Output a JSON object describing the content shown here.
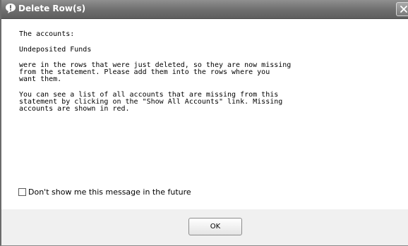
{
  "window": {
    "title": "Delete Row(s)"
  },
  "message": {
    "line1": "The accounts:",
    "line2": "Undeposited Funds",
    "para1": "were in the rows that were just deleted, so they are now missing\nfrom the statement. Please add them into the rows where you\nwant them.",
    "para2": "You can see a list of all accounts that are missing from this\nstatement by clicking on the \"Show All Accounts\" link. Missing\naccounts are shown in red."
  },
  "checkbox": {
    "label": "Don't show me this message in the future",
    "checked": false
  },
  "buttons": {
    "ok_label": "OK"
  },
  "icons": {
    "title": "info-bubble-icon",
    "close": "close-icon"
  },
  "colors": {
    "titlebar": "#6e6e6e",
    "footer": "#f0f0f0"
  }
}
